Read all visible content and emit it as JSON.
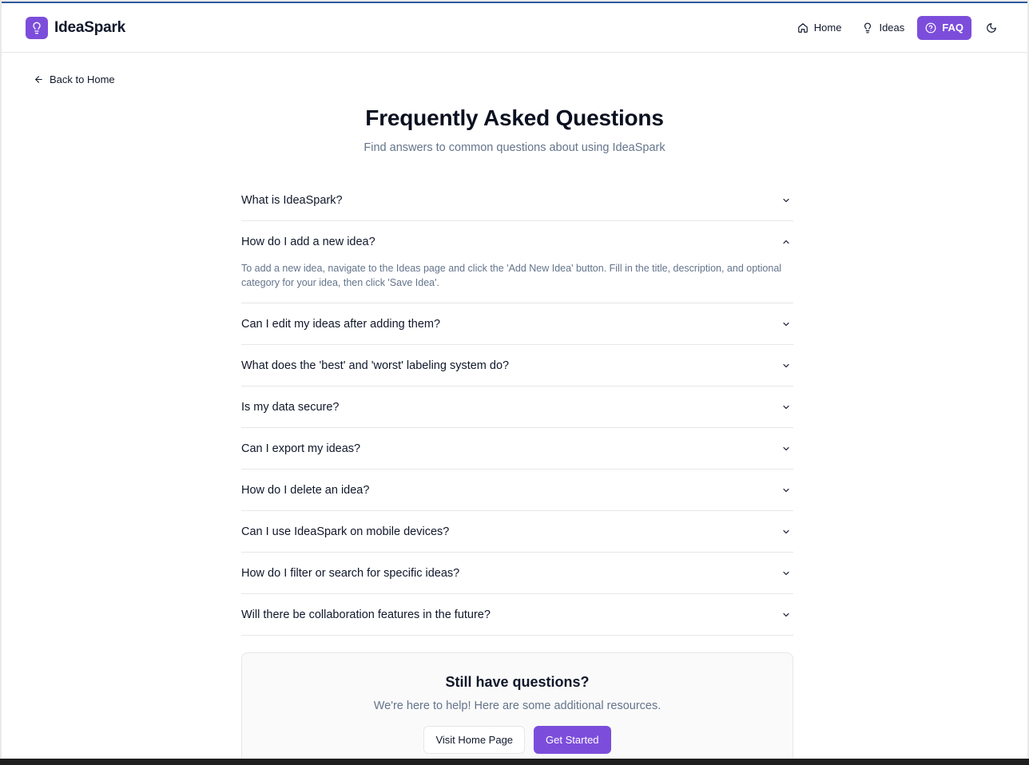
{
  "brand": {
    "name": "IdeaSpark",
    "color": "#7c4ddb"
  },
  "nav": {
    "items": [
      {
        "label": "Home",
        "icon": "home-icon",
        "active": false
      },
      {
        "label": "Ideas",
        "icon": "lightbulb-icon",
        "active": false
      },
      {
        "label": "FAQ",
        "icon": "help-circle-icon",
        "active": true
      }
    ],
    "theme_toggle_icon": "moon-icon"
  },
  "back_link": {
    "label": "Back to Home",
    "icon": "arrow-left-icon"
  },
  "page": {
    "title": "Frequently Asked Questions",
    "subtitle": "Find answers to common questions about using IdeaSpark"
  },
  "faq": [
    {
      "question": "What is IdeaSpark?",
      "expanded": false
    },
    {
      "question": "How do I add a new idea?",
      "expanded": true,
      "answer": "To add a new idea, navigate to the Ideas page and click the 'Add New Idea' button. Fill in the title, description, and optional category for your idea, then click 'Save Idea'."
    },
    {
      "question": "Can I edit my ideas after adding them?",
      "expanded": false
    },
    {
      "question": "What does the 'best' and 'worst' labeling system do?",
      "expanded": false
    },
    {
      "question": "Is my data secure?",
      "expanded": false
    },
    {
      "question": "Can I export my ideas?",
      "expanded": false
    },
    {
      "question": "How do I delete an idea?",
      "expanded": false
    },
    {
      "question": "Can I use IdeaSpark on mobile devices?",
      "expanded": false
    },
    {
      "question": "How do I filter or search for specific ideas?",
      "expanded": false
    },
    {
      "question": "Will there be collaboration features in the future?",
      "expanded": false
    }
  ],
  "help": {
    "title": "Still have questions?",
    "text": "We're here to help! Here are some additional resources.",
    "secondary_button": "Visit Home Page",
    "primary_button": "Get Started"
  }
}
